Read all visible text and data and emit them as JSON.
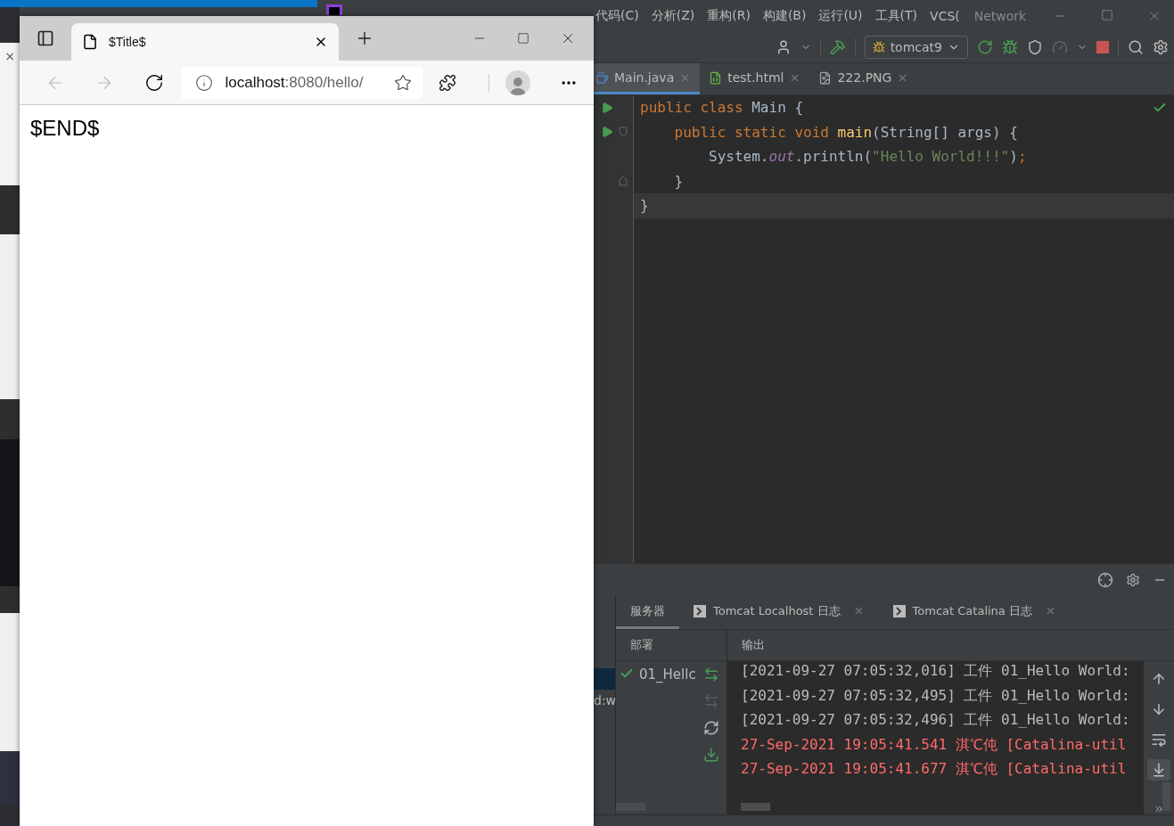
{
  "desktop": {
    "close_glyph": "×",
    "side_text": "d:w"
  },
  "ide": {
    "menu": [
      "代码(C)",
      "分析(Z)",
      "重构(R)",
      "构建(B)",
      "运行(U)",
      "工具(T)",
      "VCS("
    ],
    "title": "Network",
    "run_config": "tomcat9",
    "tabs": [
      {
        "label": "Main.java",
        "selected": true,
        "kind": "java"
      },
      {
        "label": "test.html",
        "selected": false,
        "kind": "html"
      },
      {
        "label": "222.PNG",
        "selected": false,
        "kind": "image"
      }
    ],
    "code_lines": [
      {
        "run": true,
        "fold_start": false,
        "fold_end": false,
        "current": false,
        "tokens": [
          {
            "kind": "keyword",
            "t": "public class "
          },
          {
            "kind": "plain",
            "t": "Main {"
          }
        ]
      },
      {
        "run": true,
        "fold_start": true,
        "fold_end": false,
        "current": false,
        "tokens": [
          {
            "kind": "keyword",
            "t": "    public static void "
          },
          {
            "kind": "method",
            "t": "main"
          },
          {
            "kind": "plain",
            "t": "(String[] args) {"
          }
        ]
      },
      {
        "run": false,
        "fold_start": false,
        "fold_end": false,
        "current": false,
        "tokens": [
          {
            "kind": "plain",
            "t": "        System."
          },
          {
            "kind": "field",
            "t": "out"
          },
          {
            "kind": "plain",
            "t": ".println("
          },
          {
            "kind": "string",
            "t": "\"Hello World!!!\""
          },
          {
            "kind": "plain",
            "t": ")"
          },
          {
            "kind": "keyword",
            "t": ";"
          }
        ]
      },
      {
        "run": false,
        "fold_start": false,
        "fold_end": true,
        "current": false,
        "tokens": [
          {
            "kind": "plain",
            "t": "    }"
          }
        ]
      },
      {
        "run": false,
        "fold_start": false,
        "fold_end": false,
        "current": true,
        "tokens": [
          {
            "kind": "plain",
            "t": "}"
          }
        ]
      }
    ],
    "services": {
      "tabs": [
        {
          "label": "服务器",
          "selected": true,
          "closable": false
        },
        {
          "label": "Tomcat Localhost 日志",
          "selected": false,
          "closable": true
        },
        {
          "label": "Tomcat Catalina 日志",
          "selected": false,
          "closable": true
        }
      ],
      "deploy_header": "部署",
      "output_header": "输出",
      "deployment": {
        "name": "01_Hellc",
        "ok": true
      },
      "log_lines": [
        {
          "error": false,
          "text": "[2021-09-27 07:05:32,016] 工件 01_Hello World:"
        },
        {
          "error": false,
          "text": "[2021-09-27 07:05:32,495] 工件 01_Hello World:"
        },
        {
          "error": false,
          "text": "[2021-09-27 07:05:32,496] 工件 01_Hello World:"
        },
        {
          "error": true,
          "text": "27-Sep-2021 19:05:41.541 淇℃伅 [Catalina-util"
        },
        {
          "error": true,
          "text": "27-Sep-2021 19:05:41.677 淇℃伅 [Catalina-util"
        }
      ]
    }
  },
  "browser": {
    "tab_title": "$Title$",
    "url_host": "localhost",
    "url_rest": ":8080/hello/",
    "content": "$END$"
  }
}
